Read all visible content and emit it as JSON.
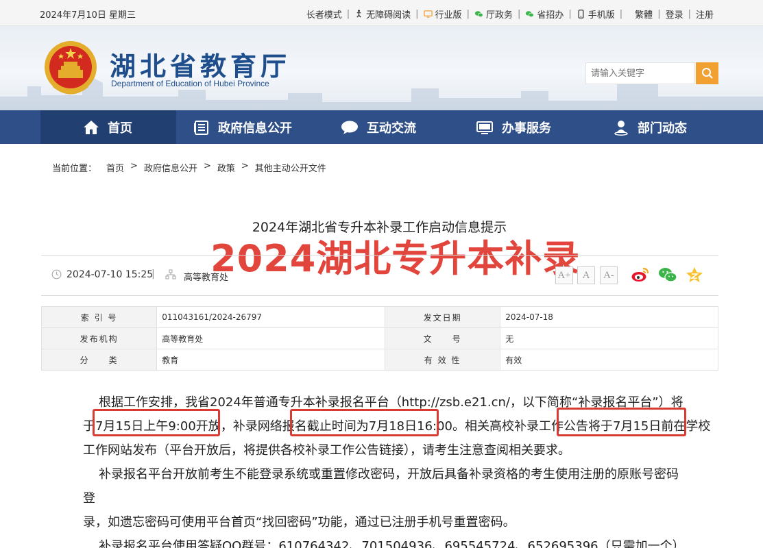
{
  "topbar": {
    "date": "2024年7月10日 星期三",
    "links": [
      {
        "label": "长者模式",
        "icon": "none"
      },
      {
        "label": "无障碍阅读",
        "icon": "accessibility-icon"
      },
      {
        "label": "行业版",
        "icon": "monitor-icon"
      },
      {
        "label": "厅政务",
        "icon": "wechat-icon"
      },
      {
        "label": "省招办",
        "icon": "wechat-icon"
      },
      {
        "label": "手机版",
        "icon": "phone-icon"
      },
      {
        "label": "繁體",
        "icon": "none"
      },
      {
        "label": "登录",
        "icon": "none"
      },
      {
        "label": "注册",
        "icon": "none"
      }
    ]
  },
  "header": {
    "title": "湖北省教育厅",
    "subtitle": "Department of Education of Hubei Province",
    "search_placeholder": "请输入关键字",
    "accent_color": "#f0a132"
  },
  "nav": {
    "items": [
      {
        "label": "首页",
        "icon": "home-icon",
        "active": true
      },
      {
        "label": "政府信息公开",
        "icon": "document-icon",
        "active": false
      },
      {
        "label": "互动交流",
        "icon": "chat-bubble-icon",
        "active": false
      },
      {
        "label": "办事服务",
        "icon": "computer-icon",
        "active": false
      },
      {
        "label": "部门动态",
        "icon": "person-pin-icon",
        "active": false
      }
    ],
    "color": "#2e4f87"
  },
  "breadcrumb": {
    "prefix": "当前位置：",
    "items": [
      "首页",
      "政府信息公开",
      "政策",
      "其他主动公开文件"
    ],
    "separator": ">"
  },
  "article": {
    "title": "2024年湖北省专升本补录工作启动信息提示",
    "overlay": "2024湖北专升本补录",
    "datetime": "2024-07-10 15:25",
    "meta_separator": "|",
    "publisher": "高等教育处",
    "font_sizes": [
      "A+",
      "A",
      "A-"
    ]
  },
  "info_table": {
    "rows": [
      {
        "l1": "索 引 号",
        "v1": "011043161/2024-26797",
        "l2": "发文日期",
        "v2": "2024-07-18"
      },
      {
        "l1": "发布机构",
        "v1": "高等教育处",
        "l2": "文　　号",
        "v2": "无"
      },
      {
        "l1": "分　　类",
        "v1": "教育",
        "l2": "有 效 性",
        "v2": "有效"
      }
    ]
  },
  "content": {
    "p1a": "根据工作安排，我省2024年普通专升本补录报名平台（http://zsb.e21.cn/，以下简称“补录报名平台”）将",
    "p1b_1": "于",
    "p1b_2": "7月15日上午9:00开放，",
    "p1b_3": "补录网络报名",
    "p1b_4": "截止时间为7月18日16:00。",
    "p1b_5": "相关高校补录工作公告",
    "p1b_6": "将于7月15日前在学校",
    "p1c": "工作网站发布（平台开放后，将提供各校补录工作公告链接），请考生注意查阅相关要求。",
    "p2a": "补录报名平台开放前考生不能登录系统或重置修改密码，开放后具备补录资格的考生使用注册的原账号密码登",
    "p2b": "录，如遗忘密码可使用平台首页“找回密码”功能，通过已注册手机号重置密码。",
    "p3": "补录报名平台使用答疑QQ群号：610764342、701504936、695545724、652695396（只需加一个）",
    "highlight_color": "#d93a32"
  }
}
